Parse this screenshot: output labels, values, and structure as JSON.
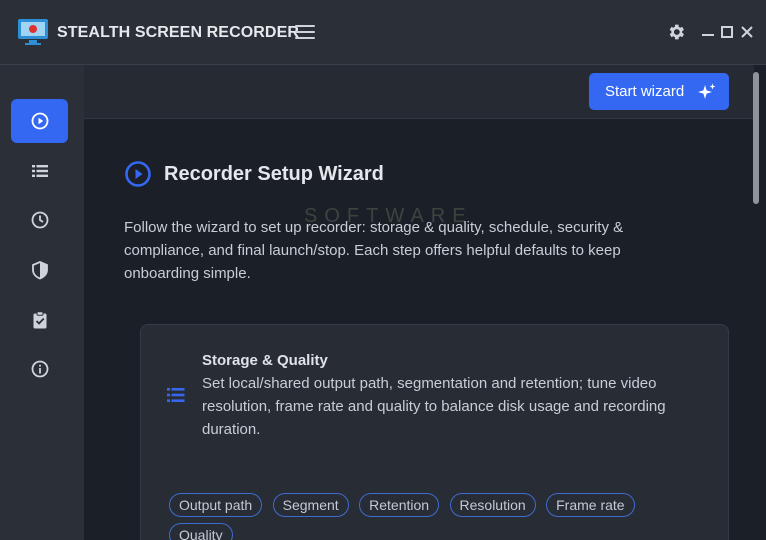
{
  "app": {
    "title": "STEALTH SCREEN RECORDER"
  },
  "colors": {
    "accent": "#3468f2",
    "titlebar": "#2b2f38",
    "background": "#1b1f28",
    "card": "#282c35"
  },
  "icons": {
    "titlebar": [
      "monitor-record-icon",
      "hamburger-icon",
      "gear-icon",
      "minimize-icon",
      "maximize-icon",
      "close-icon"
    ],
    "sidebar": [
      "play-circle-icon",
      "list-icon",
      "clock-icon",
      "shield-icon",
      "clipboard-check-icon",
      "info-icon"
    ]
  },
  "toolbar": {
    "start_wizard_label": "Start wizard"
  },
  "watermark": "SOFTWARE",
  "wizard": {
    "title": "Recorder Setup Wizard",
    "description": "Follow the wizard to set up recorder: storage & quality, schedule, security & compliance, and final launch/stop. Each step offers helpful defaults to keep onboarding simple."
  },
  "card": {
    "title": "Storage & Quality",
    "description": "Set local/shared output path, segmentation and retention; tune video resolution, frame rate and quality to balance disk usage and recording duration.",
    "chips": [
      "Output path",
      "Segment",
      "Retention",
      "Resolution",
      "Frame rate",
      "Quality"
    ]
  }
}
